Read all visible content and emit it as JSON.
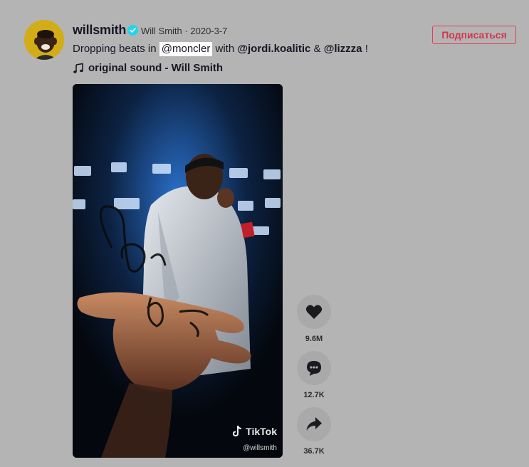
{
  "post": {
    "username": "willsmith",
    "nickname": "Will Smith",
    "separator": "·",
    "date": "2020-3-7",
    "follow_label": "Подписаться",
    "caption": {
      "prefix": "Dropping beats in",
      "mention1": "@moncler",
      "mid1": "with",
      "mention2": "@jordi.koalitic",
      "mid2": "&",
      "mention3": "@lizzza",
      "suffix": "!"
    },
    "music_title": "original sound - Will Smith"
  },
  "video": {
    "watermark_brand": "TikTok",
    "watermark_user": "@willsmith"
  },
  "actions": [
    {
      "icon": "heart-icon",
      "count": "9.6M"
    },
    {
      "icon": "comment-icon",
      "count": "12.7K"
    },
    {
      "icon": "share-icon",
      "count": "36.7K"
    }
  ],
  "colors": {
    "background": "#b4b4b4",
    "follow_accent": "#e23f55",
    "verified": "#20d5ec"
  }
}
